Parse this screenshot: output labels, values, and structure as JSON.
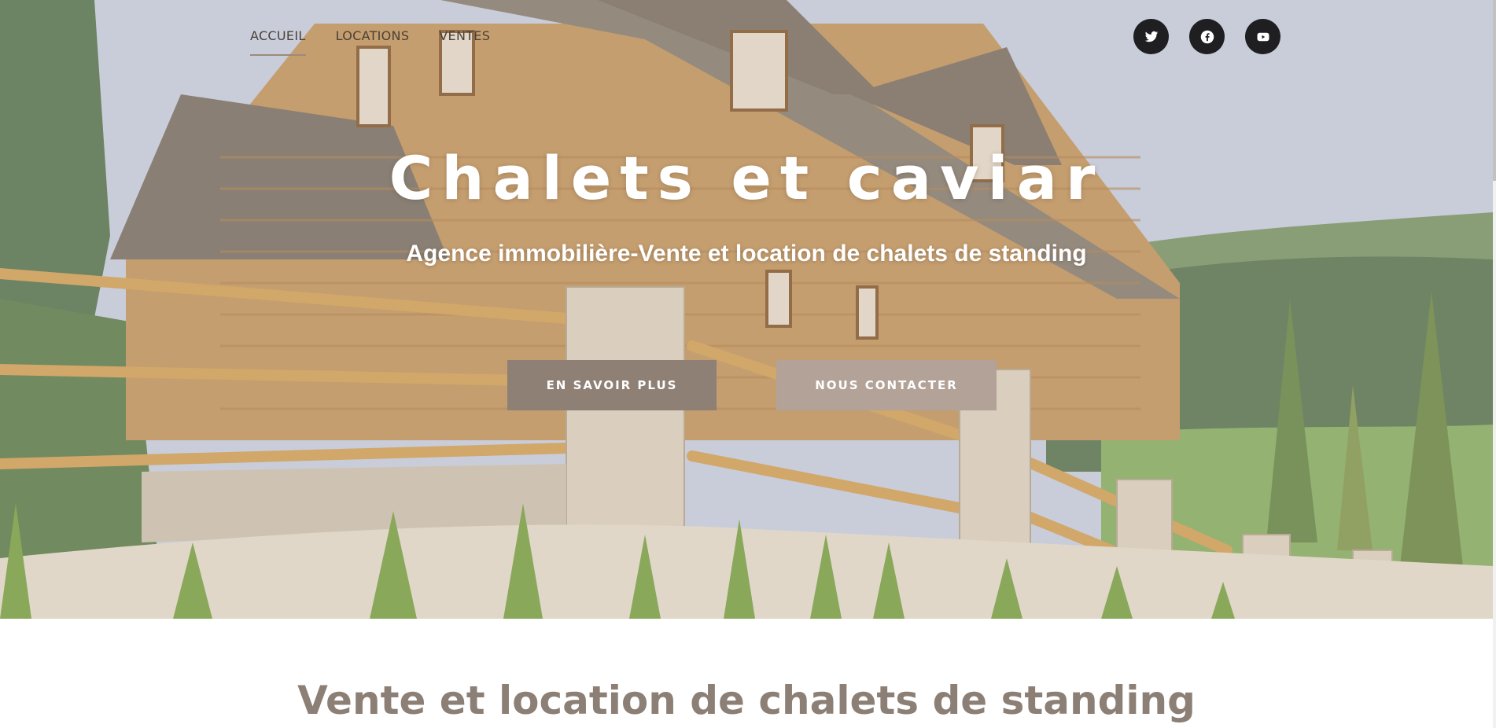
{
  "nav": {
    "items": [
      {
        "label": "ACCUEIL",
        "active": true
      },
      {
        "label": "LOCATIONS",
        "active": false
      },
      {
        "label": "VENTES",
        "active": false
      }
    ]
  },
  "social": {
    "icons": [
      "twitter-icon",
      "facebook-icon",
      "youtube-icon"
    ]
  },
  "hero": {
    "title": "Chalets et caviar",
    "subtitle": "Agence immobilière-Vente et location de chalets de standing",
    "primary_button": "EN SAVOIR PLUS",
    "secondary_button": "NOUS CONTACTER"
  },
  "main": {
    "heading": "Vente et location de chalets de standing"
  },
  "colors": {
    "button_primary": "#8e8075",
    "button_secondary": "#b2a297",
    "heading": "#8c7f75",
    "social_bg": "#1f1f22"
  }
}
